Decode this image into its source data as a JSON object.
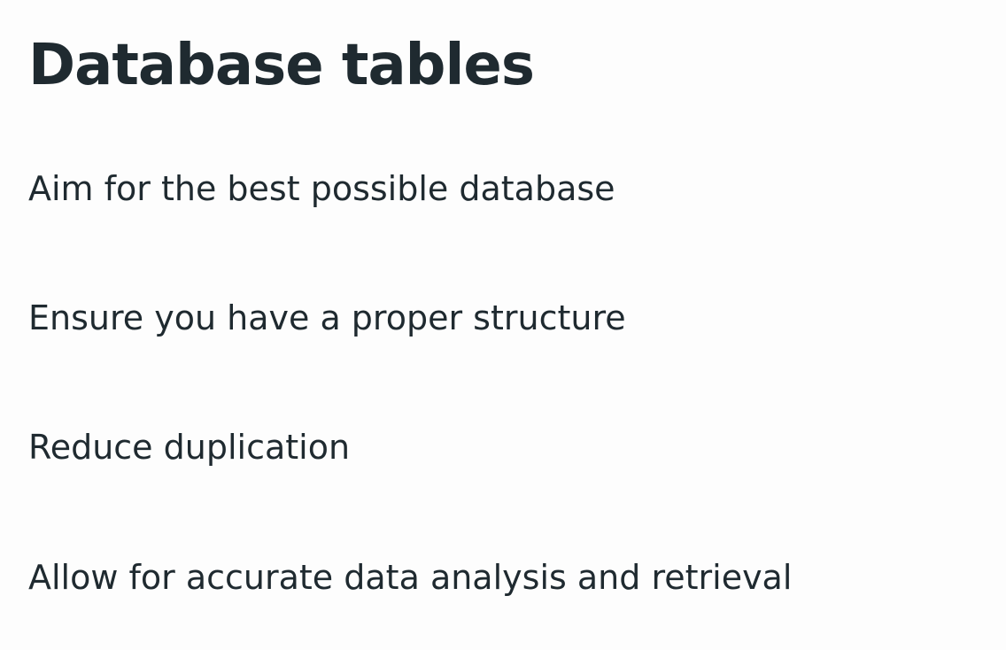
{
  "slide": {
    "title": "Database tables",
    "points": [
      "Aim for the best possible database",
      "Ensure you have a proper structure",
      "Reduce duplication",
      "Allow for accurate data analysis and retrieval"
    ]
  }
}
